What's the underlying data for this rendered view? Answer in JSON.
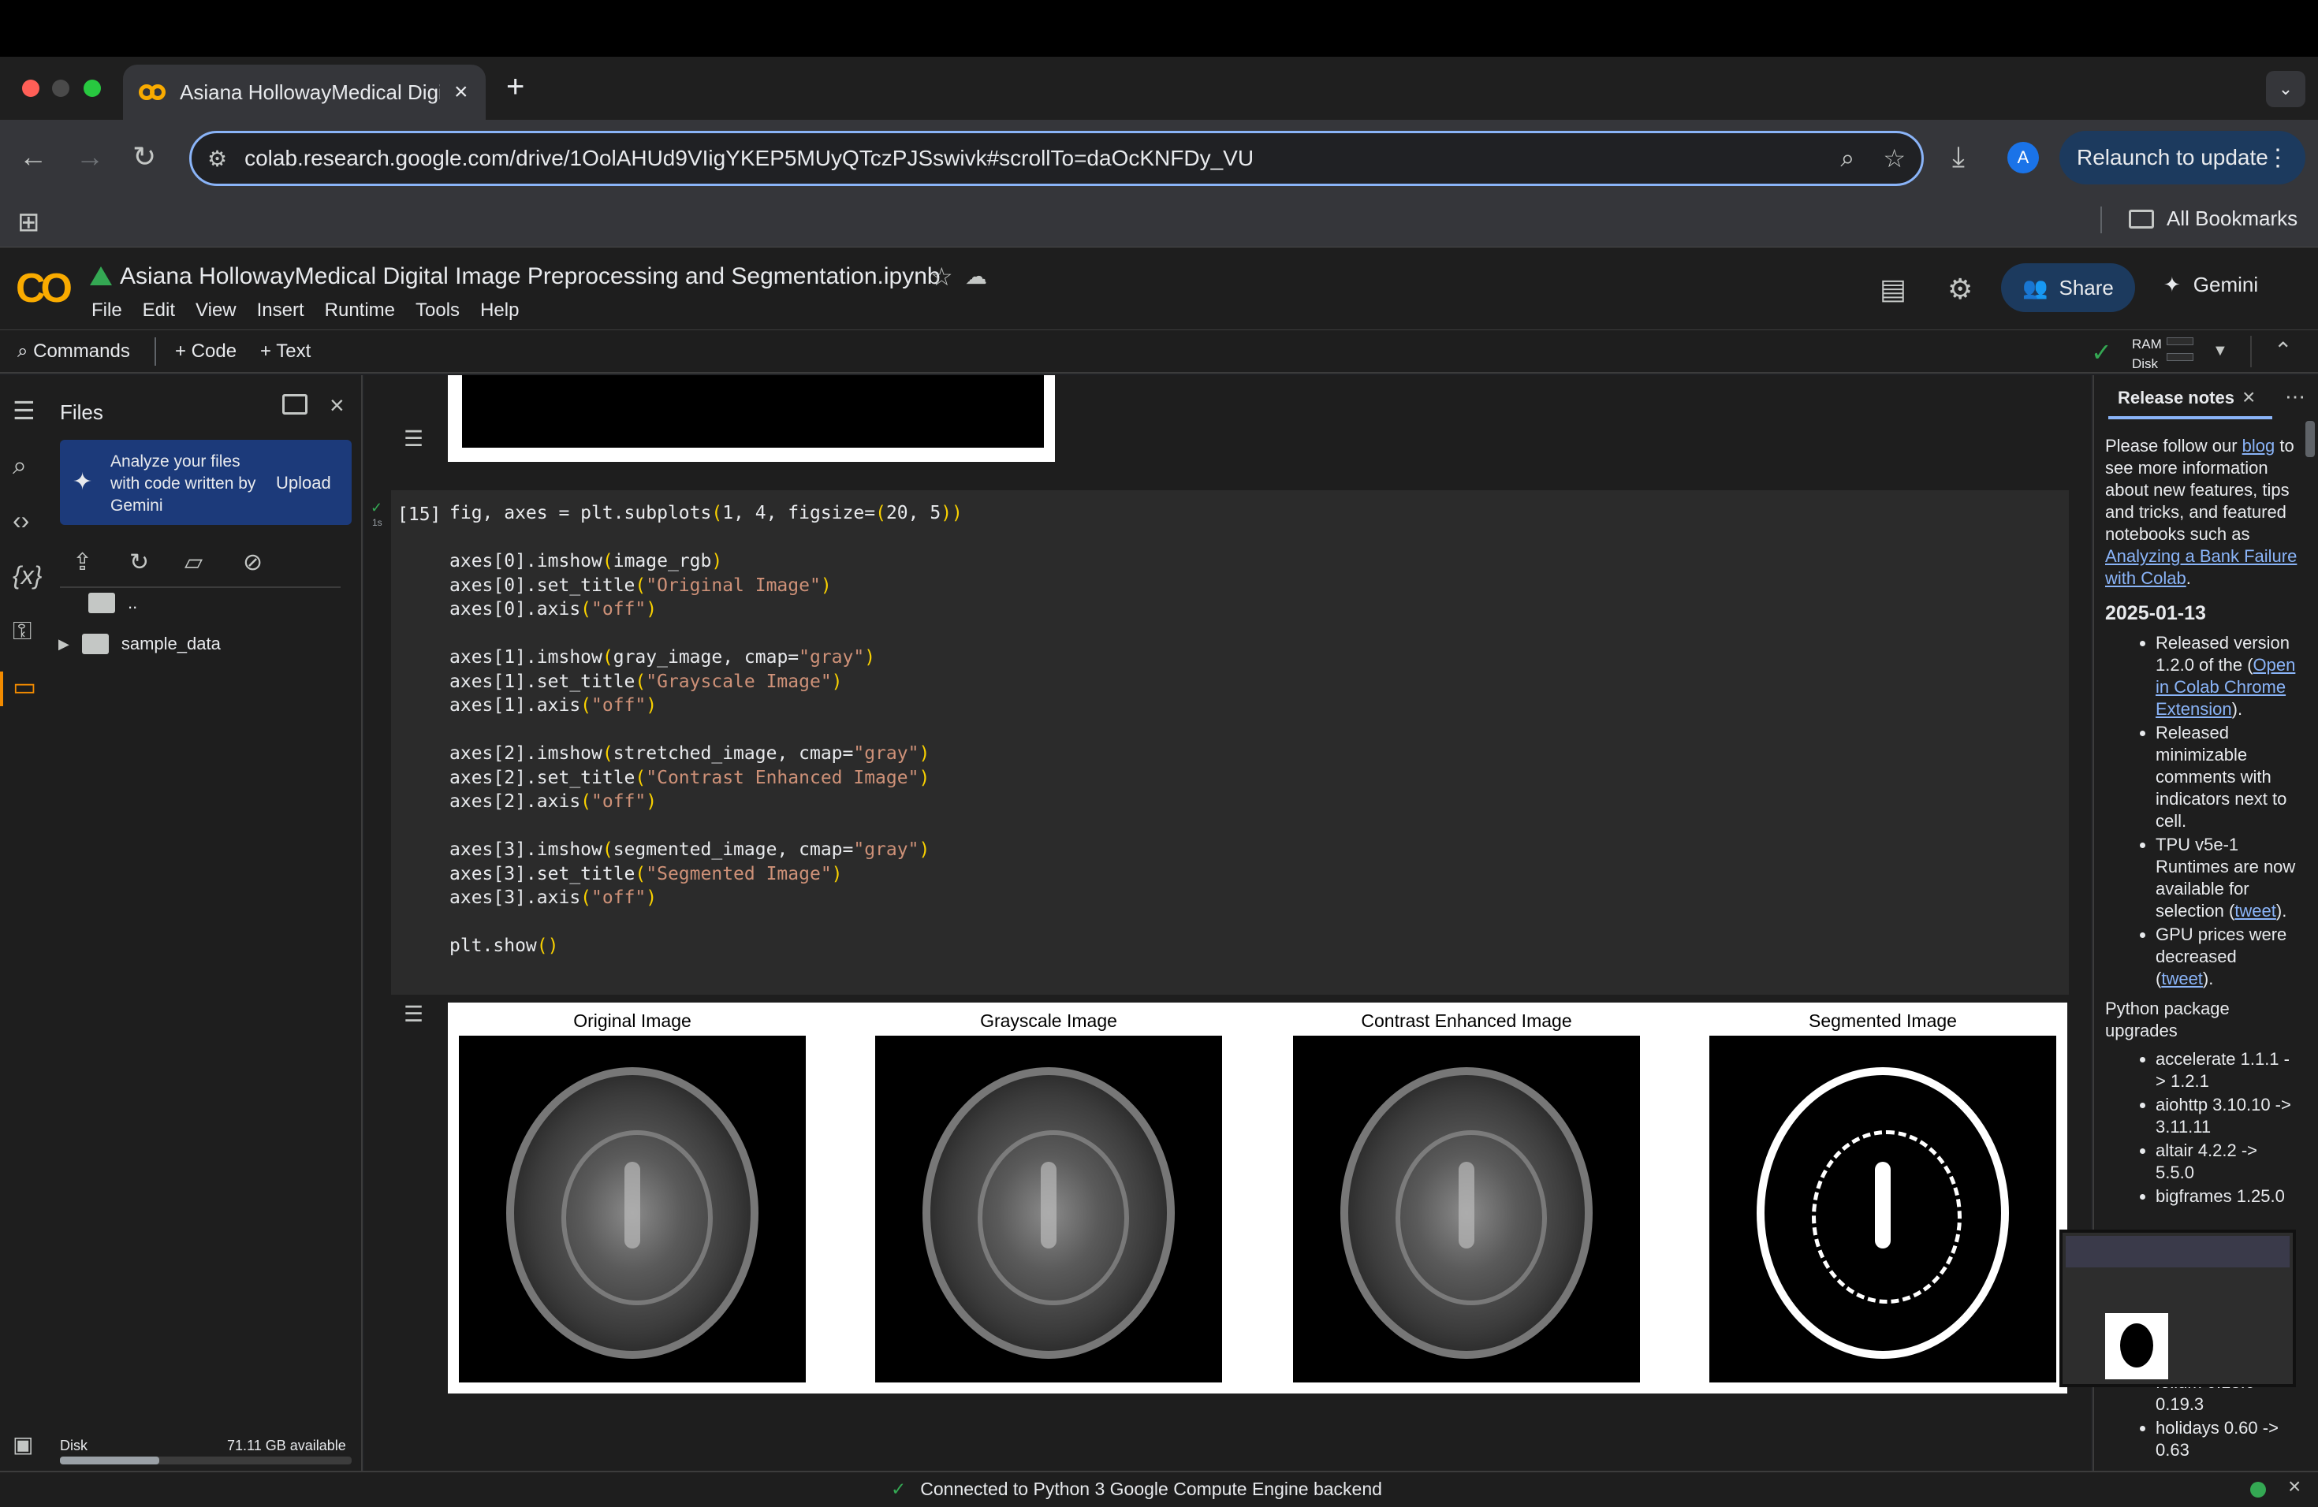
{
  "browser": {
    "tab_title": "Asiana HollowayMedical Digit",
    "url": "colab.research.google.com/drive/1OolAHUd9VIigYKEP5MUyQTczPJSswivk#scrollTo=daOcKNFDy_VU",
    "profile_initial": "A",
    "relaunch_label": "Relaunch to update",
    "all_bookmarks": "All Bookmarks"
  },
  "colab": {
    "notebook_title": "Asiana HollowayMedical Digital Image Preprocessing and Segmentation.ipynb",
    "menu": [
      "File",
      "Edit",
      "View",
      "Insert",
      "Runtime",
      "Tools",
      "Help"
    ],
    "share_label": "Share",
    "gemini_label": "Gemini",
    "toolbar": {
      "commands": "Commands",
      "code": "+ Code",
      "text": "+ Text",
      "ram": "RAM",
      "disk": "Disk"
    }
  },
  "files": {
    "title": "Files",
    "gemini_card": "Analyze your files with code written by Gemini",
    "upload": "Upload",
    "parent_dir": "..",
    "folder": "sample_data",
    "disk_label": "Disk",
    "disk_free": "71.11 GB available",
    "disk_used_fraction": 0.34
  },
  "cell": {
    "exec_count": "[15]",
    "exec_time": "1s",
    "code_lines": [
      [
        {
          "t": "fig, axes = plt.subplots"
        },
        {
          "t": "(",
          "c": "br"
        },
        {
          "t": "1, 4, figsize="
        },
        {
          "t": "(",
          "c": "br"
        },
        {
          "t": "20, 5"
        },
        {
          "t": "))",
          "c": "br"
        }
      ],
      [],
      [
        {
          "t": "axes[0].imshow"
        },
        {
          "t": "(",
          "c": "br"
        },
        {
          "t": "image_rgb"
        },
        {
          "t": ")",
          "c": "br"
        }
      ],
      [
        {
          "t": "axes[0].set_title"
        },
        {
          "t": "(",
          "c": "br"
        },
        {
          "t": "\"Original Image\"",
          "c": "str"
        },
        {
          "t": ")",
          "c": "br"
        }
      ],
      [
        {
          "t": "axes[0].axis"
        },
        {
          "t": "(",
          "c": "br"
        },
        {
          "t": "\"off\"",
          "c": "str"
        },
        {
          "t": ")",
          "c": "br"
        }
      ],
      [],
      [
        {
          "t": "axes[1].imshow"
        },
        {
          "t": "(",
          "c": "br"
        },
        {
          "t": "gray_image, cmap="
        },
        {
          "t": "\"gray\"",
          "c": "str"
        },
        {
          "t": ")",
          "c": "br"
        }
      ],
      [
        {
          "t": "axes[1].set_title"
        },
        {
          "t": "(",
          "c": "br"
        },
        {
          "t": "\"Grayscale Image\"",
          "c": "str"
        },
        {
          "t": ")",
          "c": "br"
        }
      ],
      [
        {
          "t": "axes[1].axis"
        },
        {
          "t": "(",
          "c": "br"
        },
        {
          "t": "\"off\"",
          "c": "str"
        },
        {
          "t": ")",
          "c": "br"
        }
      ],
      [],
      [
        {
          "t": "axes[2].imshow"
        },
        {
          "t": "(",
          "c": "br"
        },
        {
          "t": "stretched_image, cmap="
        },
        {
          "t": "\"gray\"",
          "c": "str"
        },
        {
          "t": ")",
          "c": "br"
        }
      ],
      [
        {
          "t": "axes[2].set_title"
        },
        {
          "t": "(",
          "c": "br"
        },
        {
          "t": "\"Contrast Enhanced Image\"",
          "c": "str"
        },
        {
          "t": ")",
          "c": "br"
        }
      ],
      [
        {
          "t": "axes[2].axis"
        },
        {
          "t": "(",
          "c": "br"
        },
        {
          "t": "\"off\"",
          "c": "str"
        },
        {
          "t": ")",
          "c": "br"
        }
      ],
      [],
      [
        {
          "t": "axes[3].imshow"
        },
        {
          "t": "(",
          "c": "br"
        },
        {
          "t": "segmented_image, cmap="
        },
        {
          "t": "\"gray\"",
          "c": "str"
        },
        {
          "t": ")",
          "c": "br"
        }
      ],
      [
        {
          "t": "axes[3].set_title"
        },
        {
          "t": "(",
          "c": "br"
        },
        {
          "t": "\"Segmented Image\"",
          "c": "str"
        },
        {
          "t": ")",
          "c": "br"
        }
      ],
      [
        {
          "t": "axes[3].axis"
        },
        {
          "t": "(",
          "c": "br"
        },
        {
          "t": "\"off\"",
          "c": "str"
        },
        {
          "t": ")",
          "c": "br"
        }
      ],
      [],
      [
        {
          "t": "plt.show"
        },
        {
          "t": "()",
          "c": "br"
        }
      ]
    ]
  },
  "output": {
    "titles": [
      "Original Image",
      "Grayscale Image",
      "Contrast Enhanced Image",
      "Segmented Image"
    ]
  },
  "release_notes": {
    "tab_label": "Release notes",
    "intro_pre": "Please follow our ",
    "blog_link": "blog",
    "intro_mid": " to see more information about new features, tips and tricks, and featured notebooks such as ",
    "featured_link": "Analyzing a Bank Failure with Colab",
    "intro_post": ".",
    "date": "2025-01-13",
    "items": [
      {
        "pre": "Released version 1.2.0 of the (",
        "link": "Open in Colab Chrome Extension",
        "post": ")."
      },
      {
        "pre": "Released minimizable comments with indicators next to cell.",
        "link": "",
        "post": ""
      },
      {
        "pre": "TPU v5e-1 Runtimes are now available for selection (",
        "link": "tweet",
        "post": ")."
      },
      {
        "pre": "GPU prices were decreased (",
        "link": "tweet",
        "post": ")."
      }
    ],
    "upgrades_heading": "Python package upgrades",
    "upgrades": [
      "accelerate 1.1.1 -> 1.2.1",
      "aiohttp 3.10.10 -> 3.11.11",
      "altair 4.2.2 -> 5.5.0",
      "bigframes 1.25.0",
      "folium 0.18.0 -> 0.19.3",
      "holidays 0.60 -> 0.63"
    ]
  },
  "status": {
    "text": "Connected to Python 3 Google Compute Engine backend"
  },
  "colors": {
    "accent": "#8ab4f8",
    "ok": "#34a853",
    "colab_orange": "#f9ab00",
    "string": "#ce9178",
    "bracket": "#f9d100"
  }
}
